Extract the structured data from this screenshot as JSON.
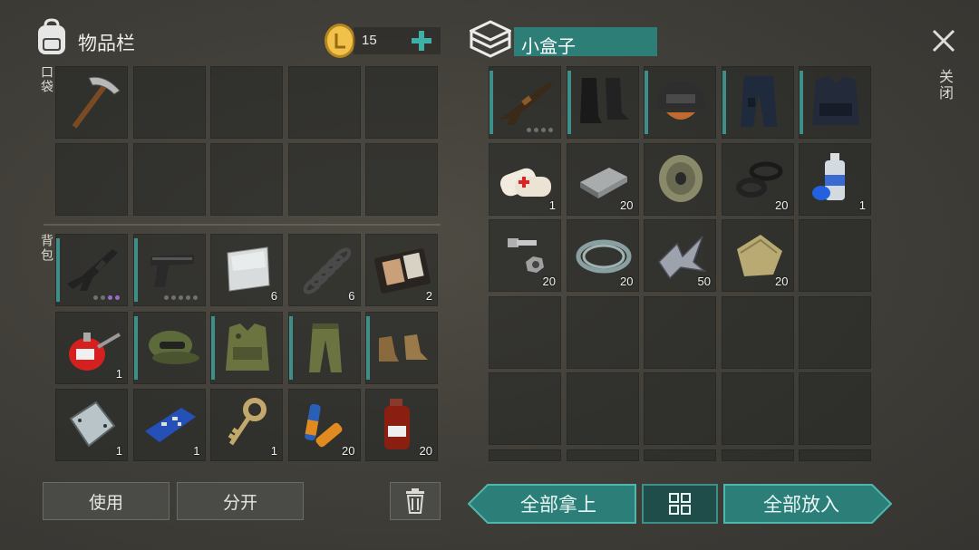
{
  "inventory": {
    "title": "物品栏",
    "coins": "15",
    "pocket_label": "口袋",
    "backpack_label": "背包",
    "pocket_items": [
      {
        "icon": "pickaxe-icon",
        "qty": ""
      }
    ],
    "backpack_items": [
      {
        "icon": "assault-rifle-icon",
        "qty": "",
        "bar": true
      },
      {
        "icon": "pistol-icon",
        "qty": "",
        "bar": true
      },
      {
        "icon": "metal-sheet-icon",
        "qty": "6"
      },
      {
        "icon": "spring-icon",
        "qty": "6"
      },
      {
        "icon": "wallet-documents-icon",
        "qty": "2"
      },
      {
        "icon": "oil-can-icon",
        "qty": "1"
      },
      {
        "icon": "camo-cap-icon",
        "qty": "",
        "bar": true
      },
      {
        "icon": "camo-vest-icon",
        "qty": "",
        "bar": true
      },
      {
        "icon": "camo-pants-icon",
        "qty": "",
        "bar": true
      },
      {
        "icon": "leather-boots-icon",
        "qty": "",
        "bar": true
      },
      {
        "icon": "steel-plate-icon",
        "qty": "1"
      },
      {
        "icon": "circuit-board-icon",
        "qty": "1"
      },
      {
        "icon": "key-icon",
        "qty": "1"
      },
      {
        "icon": "batteries-icon",
        "qty": "20"
      },
      {
        "icon": "medicine-bottle-icon",
        "qty": "20"
      }
    ],
    "buttons": {
      "use": "使用",
      "split": "分开"
    }
  },
  "container": {
    "title": "小盒子",
    "close_label": "关闭",
    "items": [
      {
        "icon": "shotgun-icon",
        "qty": "",
        "bar": true
      },
      {
        "icon": "combat-boots-icon",
        "qty": "",
        "bar": true
      },
      {
        "icon": "helmet-icon",
        "qty": "",
        "bar": true
      },
      {
        "icon": "police-pants-icon",
        "qty": "",
        "bar": true
      },
      {
        "icon": "police-vest-icon",
        "qty": "",
        "bar": true
      },
      {
        "icon": "bandage-icon",
        "qty": "1"
      },
      {
        "icon": "iron-ingot-icon",
        "qty": "20"
      },
      {
        "icon": "tape-roll-icon",
        "qty": ""
      },
      {
        "icon": "rubber-rings-icon",
        "qty": "20"
      },
      {
        "icon": "spray-paint-icon",
        "qty": "1"
      },
      {
        "icon": "bolt-nut-icon",
        "qty": "20"
      },
      {
        "icon": "wire-coil-icon",
        "qty": "20"
      },
      {
        "icon": "scrap-metal-icon",
        "qty": "50"
      },
      {
        "icon": "cloth-icon",
        "qty": "20"
      }
    ],
    "buttons": {
      "take_all": "全部拿上",
      "put_all": "全部放入"
    }
  },
  "colors": {
    "accent": "#2c7f79",
    "bar": "#3e8f8a",
    "durability_purple": "#9a6cd0"
  }
}
